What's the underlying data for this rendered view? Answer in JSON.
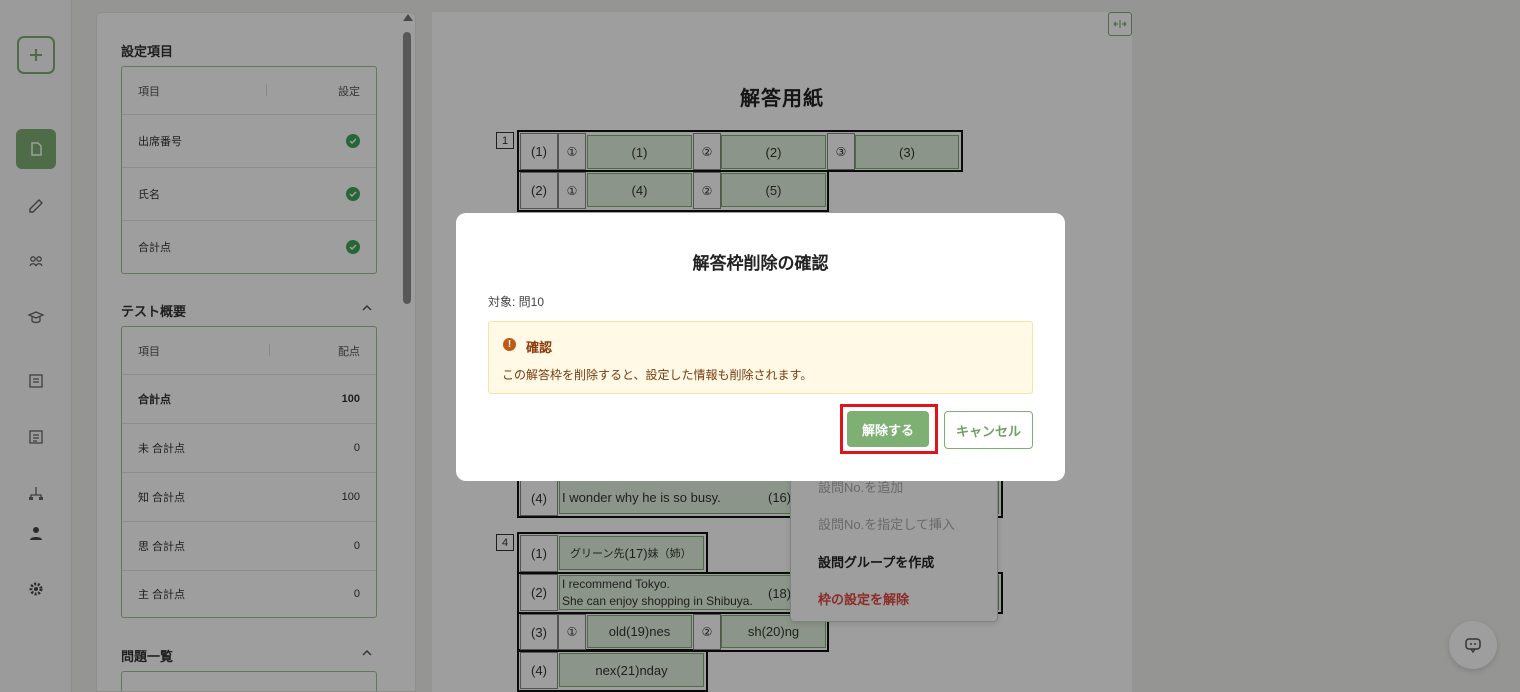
{
  "panel": {
    "settings": {
      "title": "設定項目",
      "header": {
        "item": "項目",
        "setting": "設定"
      },
      "rows": [
        {
          "label": "出席番号"
        },
        {
          "label": "氏名"
        },
        {
          "label": "合計点"
        }
      ]
    },
    "overview": {
      "title": "テスト概要",
      "header": {
        "item": "項目",
        "score": "配点"
      },
      "rows": [
        {
          "label": "合計点",
          "value": "100"
        },
        {
          "label": "未 合計点",
          "value": "0"
        },
        {
          "label": "知 合計点",
          "value": "100"
        },
        {
          "label": "思 合計点",
          "value": "0"
        },
        {
          "label": "主 合計点",
          "value": "0"
        }
      ]
    },
    "questions": {
      "title": "問題一覧"
    }
  },
  "doc": {
    "title": "解答用紙",
    "q1": "1",
    "q4": "4",
    "rows": {
      "r1": "(1)",
      "r2": "(2)",
      "r4b": "(4)",
      "s1": "(1)",
      "s2": "(2)",
      "s3": "(3)",
      "s4": "(4)"
    },
    "marks": {
      "m1": "①",
      "m2": "②",
      "m3": "③"
    },
    "cells": {
      "c1": "(1)",
      "c2": "(2)",
      "c3": "(3)",
      "c4": "(4)",
      "c5": "(5)",
      "c16": "(16)",
      "c17": "(17)",
      "c18": "(18)",
      "c19": "(19)",
      "c20": "(20)",
      "c21": "(21)"
    },
    "texts": {
      "busy": "I wonder why he is so busy.",
      "green": "グリーン先",
      "sister": "妹（姉）",
      "rec1": "I recommend Tokyo.",
      "rec2": "She can enjoy shopping in Shibuya.",
      "old": "old",
      "nes": "nes",
      "sh": "sh",
      "ng": "ng",
      "next": "nex",
      "nday": "nday"
    }
  },
  "context_menu": {
    "add": "設問No.を追加",
    "insert": "設問No.を指定して挿入",
    "group": "設問グループを作成",
    "remove": "枠の設定を解除"
  },
  "dialog": {
    "title": "解答枠削除の確認",
    "target": "対象: 問10",
    "alert_title": "確認",
    "alert_message": "この解答枠を削除すると、設定した情報も削除されます。",
    "confirm_label": "解除する",
    "cancel_label": "キャンセル"
  },
  "colors": {
    "accent": "#7eaf73",
    "check": "#3fa55a",
    "danger": "#e0473e",
    "highlight": "#e0141b",
    "alert_bg": "#fff9e5"
  }
}
